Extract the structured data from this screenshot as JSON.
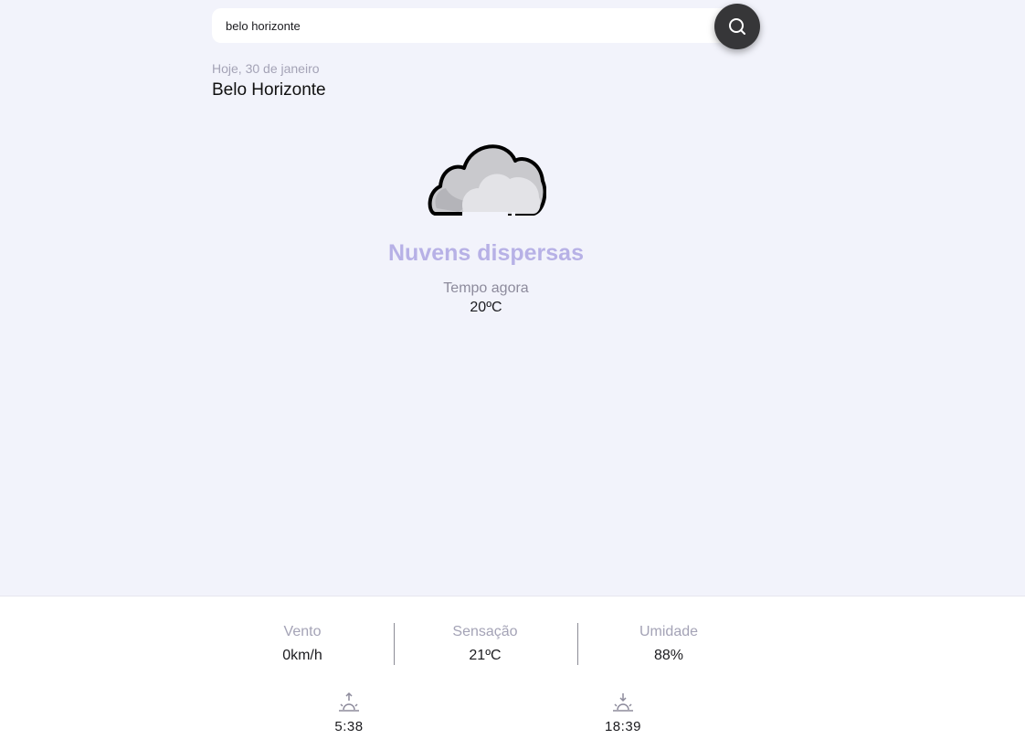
{
  "search": {
    "value": "belo horizonte",
    "button_icon": "search-icon"
  },
  "location": {
    "date": "Hoje, 30 de janeiro",
    "city": "Belo Horizonte"
  },
  "current": {
    "icon": "scattered-clouds-icon",
    "condition": "Nuvens dispersas",
    "now_label": "Tempo agora",
    "temperature": "20ºC"
  },
  "details": {
    "wind": {
      "label": "Vento",
      "value": "0km/h"
    },
    "feels_like": {
      "label": "Sensação",
      "value": "21ºC"
    },
    "humidity": {
      "label": "Umidade",
      "value": "88%"
    }
  },
  "sun": {
    "sunrise": {
      "icon": "sunrise-icon",
      "time": "5:38"
    },
    "sunset": {
      "icon": "sunset-icon",
      "time": "18:39"
    }
  },
  "colors": {
    "background": "#f2f3fb",
    "accent": "#b7b1e6",
    "muted_text": "#a4a3b6",
    "button": "#363638"
  }
}
